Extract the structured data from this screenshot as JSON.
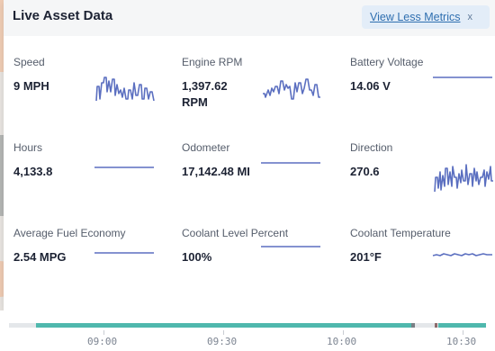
{
  "panel": {
    "title": "Live Asset Data",
    "toggle_label": "View Less Metrics",
    "close_glyph": "x"
  },
  "metrics": [
    {
      "label": "Speed",
      "value": "9 MPH",
      "sparkline": "volatile"
    },
    {
      "label": "Engine RPM",
      "value": "1,397.62 RPM",
      "sparkline": "volatile"
    },
    {
      "label": "Battery Voltage",
      "value": "14.06 V",
      "sparkline": "flat"
    },
    {
      "label": "Hours",
      "value": "4,133.8",
      "sparkline": "flat"
    },
    {
      "label": "Odometer",
      "value": "17,142.48 MI",
      "sparkline": "flat"
    },
    {
      "label": "Direction",
      "value": "270.6",
      "sparkline": "volatile"
    },
    {
      "label": "Average Fuel Economy",
      "value": "2.54 MPG",
      "sparkline": "flat"
    },
    {
      "label": "Coolant Level Percent",
      "value": "100%",
      "sparkline": "flat"
    },
    {
      "label": "Coolant Temperature",
      "value": "201°F",
      "sparkline": "slight-wave"
    }
  ],
  "timeline": {
    "labels": [
      "09:00",
      "09:30",
      "10:00",
      "10:30"
    ],
    "colors": {
      "active": "#4fb8ad",
      "idle": "#7a7f85",
      "off": "#e4e7ea",
      "alert": "#8c6b6b"
    }
  },
  "colors": {
    "sparkline": "#5b6fc0",
    "link": "#2f6fb0",
    "chip_bg": "#e3edf8"
  }
}
